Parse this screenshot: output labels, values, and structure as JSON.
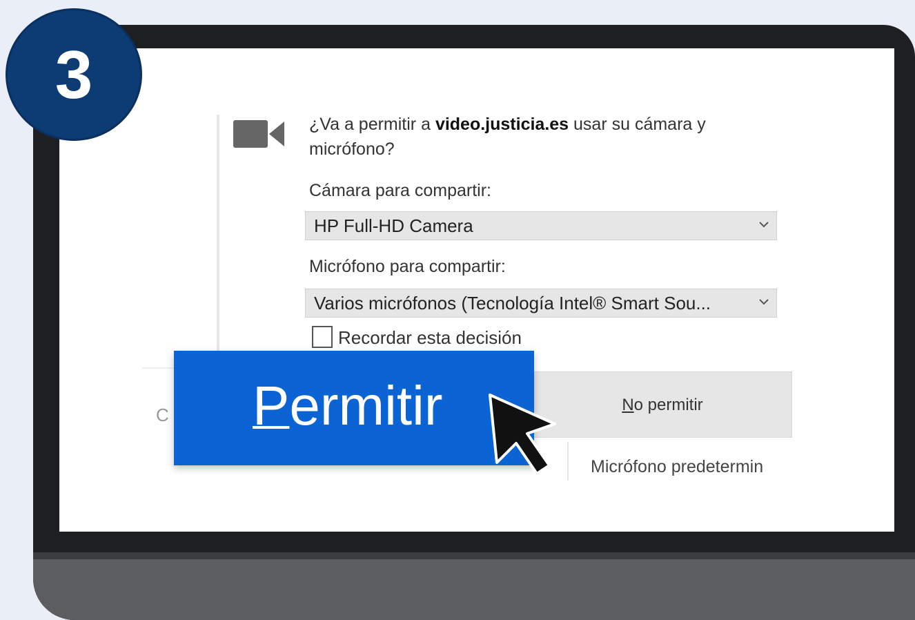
{
  "step": {
    "number": "3"
  },
  "dialog": {
    "prompt_prefix": "¿Va a permitir a ",
    "site": "video.justicia.es",
    "prompt_suffix": " usar su cámara y micrófono?",
    "camera_label": "Cámara para compartir:",
    "camera_selected": "HP Full-HD Camera",
    "mic_label": "Micrófono para compartir:",
    "mic_selected": "Varios micrófonos (Tecnología Intel® Smart Sou...",
    "remember_label": "Recordar esta decisión",
    "allow_label_first": "P",
    "allow_label_rest": "ermitir",
    "deny_label_first": "N",
    "deny_label_rest": "o permitir",
    "background_mic_text": "Micrófono predetermin"
  },
  "colors": {
    "badge": "#0d3b74",
    "allow_button": "#0b63d4",
    "frame": "#1e1f22"
  },
  "icons": [
    "camera-icon",
    "chevron-down-icon",
    "cursor-icon"
  ]
}
